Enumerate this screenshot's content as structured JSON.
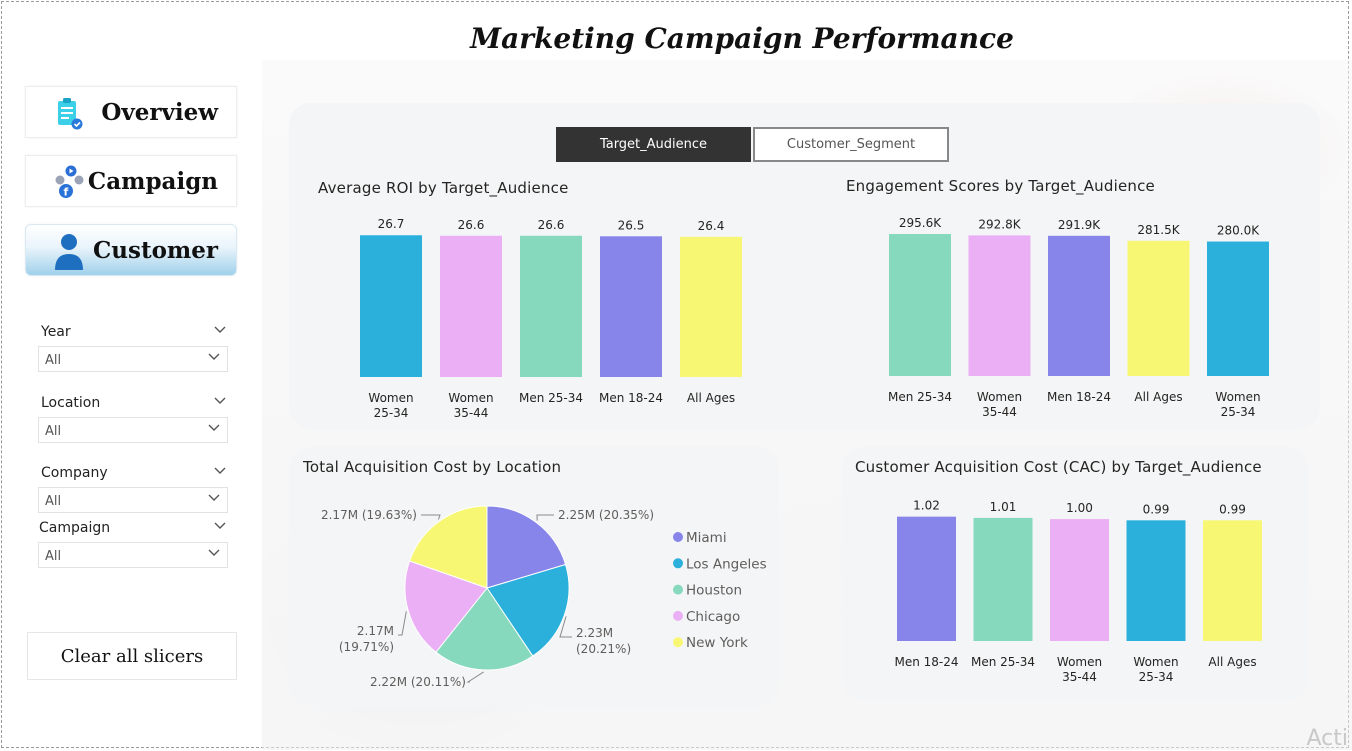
{
  "title": "Marketing Campaign Performance",
  "nav": {
    "overview": "Overview",
    "campaign": "Campaign",
    "customer": "Customer"
  },
  "slicers": [
    {
      "label": "Year",
      "value": "All"
    },
    {
      "label": "Location",
      "value": "All"
    },
    {
      "label": "Company",
      "value": "All"
    },
    {
      "label": "Campaign",
      "value": "All"
    }
  ],
  "clear_button": "Clear all slicers",
  "toggle": {
    "active": "Target_Audience",
    "inactive": "Customer_Segment"
  },
  "watermark": "Acti",
  "colors": {
    "blue": "#2bb0dc",
    "pink": "#ebaff5",
    "mint": "#86d9bd",
    "purple": "#8784ea",
    "yellow": "#f7f774"
  },
  "chart_data": [
    {
      "id": "roi",
      "type": "bar",
      "title": "Average ROI by Target_Audience",
      "categories": [
        [
          "Women",
          "25-34"
        ],
        [
          "Women",
          "35-44"
        ],
        [
          "Men 25-34"
        ],
        [
          "Men 18-24"
        ],
        [
          "All Ages"
        ]
      ],
      "values": [
        26.7,
        26.6,
        26.6,
        26.5,
        26.4
      ],
      "labels": [
        "26.7",
        "26.6",
        "26.6",
        "26.5",
        "26.4"
      ],
      "colors": [
        "#2bb0dc",
        "#ebaff5",
        "#86d9bd",
        "#8784ea",
        "#f7f774"
      ],
      "ylim": [
        0,
        27.5
      ]
    },
    {
      "id": "engagement",
      "type": "bar",
      "title": "Engagement Scores by Target_Audience",
      "categories": [
        [
          "Men 25-34"
        ],
        [
          "Women",
          "35-44"
        ],
        [
          "Men 18-24"
        ],
        [
          "All Ages"
        ],
        [
          "Women",
          "25-34"
        ]
      ],
      "values": [
        295600,
        292800,
        291900,
        281500,
        280000
      ],
      "labels": [
        "295.6K",
        "292.8K",
        "291.9K",
        "281.5K",
        "280.0K"
      ],
      "colors": [
        "#86d9bd",
        "#ebaff5",
        "#8784ea",
        "#f7f774",
        "#2bb0dc"
      ],
      "ylim": [
        0,
        304000
      ]
    },
    {
      "id": "location",
      "type": "pie",
      "title": "Total Acquisition Cost by Location",
      "legend": [
        "Miami",
        "Los Angeles",
        "Houston",
        "Chicago",
        "New York"
      ],
      "values": [
        2.25,
        2.23,
        2.22,
        2.17,
        2.17
      ],
      "percents": [
        20.35,
        20.2,
        20.11,
        19.71,
        19.63
      ],
      "slice_labels": [
        [
          "2.25M (20.35%)"
        ],
        [
          "2.23M",
          "(20.21%)"
        ],
        [
          "2.22M (20.11%)"
        ],
        [
          "2.17M",
          "(19.71%)"
        ],
        [
          "2.17M (19.63%)"
        ]
      ],
      "colors": [
        "#8784ea",
        "#2bb0dc",
        "#86d9bd",
        "#ebaff5",
        "#f7f774"
      ],
      "legend_position": "right"
    },
    {
      "id": "cac",
      "type": "bar",
      "title": "Customer Acquisition Cost (CAC) by Target_Audience",
      "categories": [
        [
          "Men 18-24"
        ],
        [
          "Men 25-34"
        ],
        [
          "Women",
          "35-44"
        ],
        [
          "Women",
          "25-34"
        ],
        [
          "All Ages"
        ]
      ],
      "values": [
        1.02,
        1.01,
        1.0,
        0.99,
        0.99
      ],
      "labels": [
        "1.02",
        "1.01",
        "1.00",
        "0.99",
        "0.99"
      ],
      "colors": [
        "#8784ea",
        "#86d9bd",
        "#ebaff5",
        "#2bb0dc",
        "#f7f774"
      ],
      "ylim": [
        0,
        1.05
      ]
    }
  ]
}
